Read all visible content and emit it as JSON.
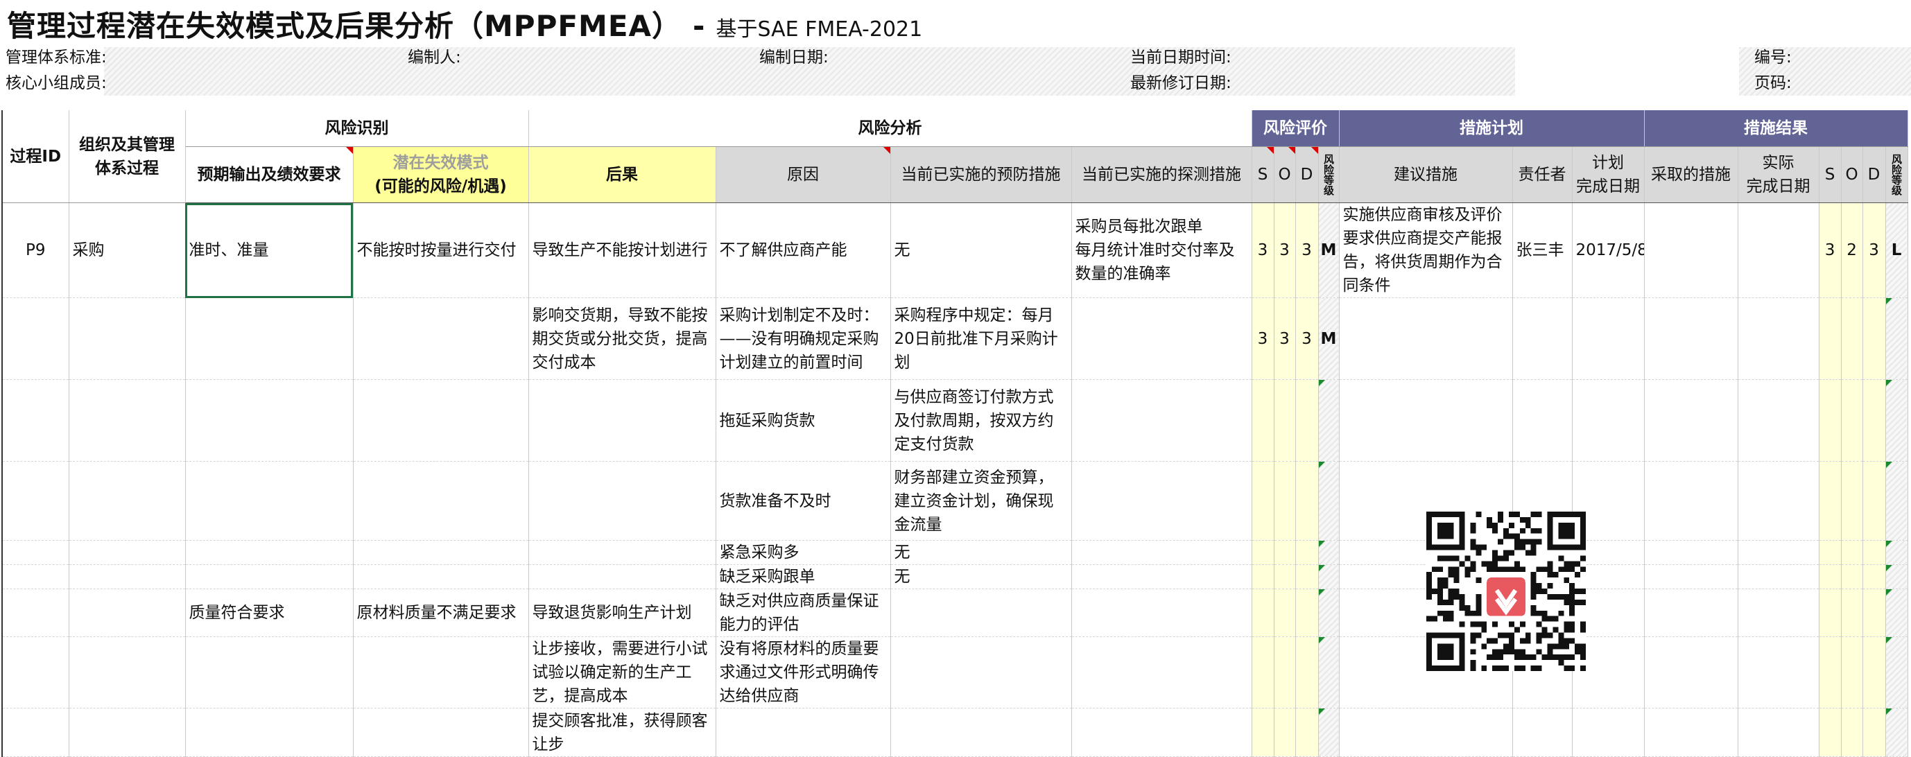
{
  "title": {
    "main": "管理过程潜在失效模式及后果分析（MPPFMEA）",
    "dash": "-",
    "sub": "基于SAE FMEA-2021"
  },
  "meta": {
    "standard": "管理体系标准:",
    "editor": "编制人:",
    "date": "编制日期:",
    "current_datetime": "当前日期时间:",
    "number": "编号:",
    "core_team": "核心小组成员:",
    "revision_date": "最新修订日期:",
    "page": "页码:"
  },
  "headers": {
    "process_id": "过程ID",
    "org_process": "组织及其管理体系过程",
    "risk_identification": "风险识别",
    "risk_analysis": "风险分析",
    "risk_evaluation": "风险评价",
    "action_plan": "措施计划",
    "action_result": "措施结果",
    "expected_output": "预期输出及绩效要求",
    "failure_mode_line1": "潜在失效模式",
    "failure_mode_line2": "(可能的风险/机遇)",
    "consequence": "后果",
    "cause": "原因",
    "prevention": "当前已实施的预防措施",
    "detection": "当前已实施的探测措施",
    "s": "S",
    "o": "O",
    "d": "D",
    "risk_level": "风险等级",
    "recommended": "建议措施",
    "owner": "责任者",
    "plan_date_line1": "计划",
    "plan_date_line2": "完成日期",
    "taken": "采取的措施",
    "actual_date_line1": "实际",
    "actual_date_line2": "完成日期",
    "s2": "S",
    "o2": "O",
    "d2": "D",
    "risk_level2": "风险等级"
  },
  "rows": {
    "r1": {
      "id": "P9",
      "process": "采购",
      "output": "准时、准量",
      "mode": "不能按时按量进行交付",
      "consequence": "导致生产不能按计划进行",
      "cause": "不了解供应商产能",
      "prevention": "无",
      "detection": "采购员每批次跟单\n每月统计准时交付率及数量的准确率",
      "s": "3",
      "o": "3",
      "d": "3",
      "level": "M",
      "recommended": "实施供应商审核及评价要求供应商提交产能报告，将供货周期作为合同条件",
      "owner": "张三丰",
      "plan_date": "2017/5/8",
      "s2": "3",
      "o2": "2",
      "d2": "3",
      "level2": "L"
    },
    "r2": {
      "consequence": "影响交货期，导致不能按期交货或分批交货，提高交付成本",
      "cause": "采购计划制定不及时：——没有明确规定采购计划建立的前置时间",
      "prevention": "采购程序中规定：每月20日前批准下月采购计划",
      "s": "3",
      "o": "3",
      "d": "3",
      "level": "M"
    },
    "r3": {
      "cause": "拖延采购货款",
      "prevention": "与供应商签订付款方式及付款周期，按双方约定支付货款"
    },
    "r4": {
      "cause": "货款准备不及时",
      "prevention": "财务部建立资金预算，建立资金计划，确保现金流量"
    },
    "r5": {
      "cause": "紧急采购多",
      "prevention": "无"
    },
    "r6": {
      "cause": "缺乏采购跟单",
      "prevention": "无"
    },
    "r7": {
      "output": "质量符合要求",
      "mode": "原材料质量不满足要求",
      "consequence": "导致退货影响生产计划",
      "cause": "缺乏对供应商质量保证能力的评估"
    },
    "r8": {
      "consequence": "让步接收，需要进行小试试验以确定新的生产工艺，提高成本",
      "cause": "没有将原材料的质量要求通过文件形式明确传达给供应商"
    },
    "r9": {
      "consequence": "提交顾客批准，获得顾客让步"
    }
  },
  "colors": {
    "purple": "#636496",
    "yellow": "#ffff99",
    "gray": "#d9d9d9",
    "selection": "#217346"
  },
  "icons": {
    "qr": "qr-code-icon"
  }
}
